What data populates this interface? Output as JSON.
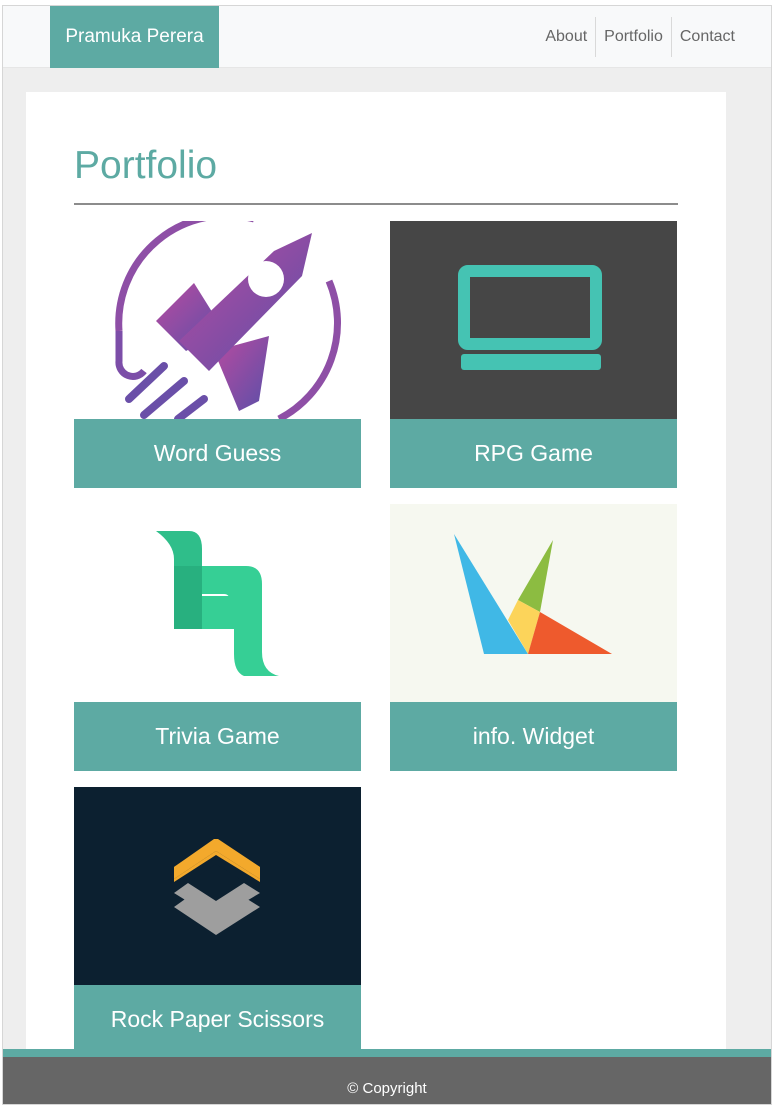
{
  "navbar": {
    "brand": "Pramuka Perera",
    "links": [
      {
        "label": "About"
      },
      {
        "label": "Portfolio"
      },
      {
        "label": "Contact"
      }
    ]
  },
  "main": {
    "title": "Portfolio",
    "projects": [
      {
        "label": "Word Guess",
        "icon": "rocket-icon"
      },
      {
        "label": "RPG Game",
        "icon": "laptop-icon"
      },
      {
        "label": "Trivia Game",
        "icon": "trivia-logo-icon"
      },
      {
        "label": "info. Widget",
        "icon": "widget-logo-icon"
      },
      {
        "label": "Rock Paper Scissors",
        "icon": "stacked-chevrons-icon"
      }
    ]
  },
  "footer": {
    "text": "© Copyright"
  },
  "colors": {
    "accent": "#5daaa3",
    "footer": "#666666",
    "page_background": "#eeeeee"
  }
}
